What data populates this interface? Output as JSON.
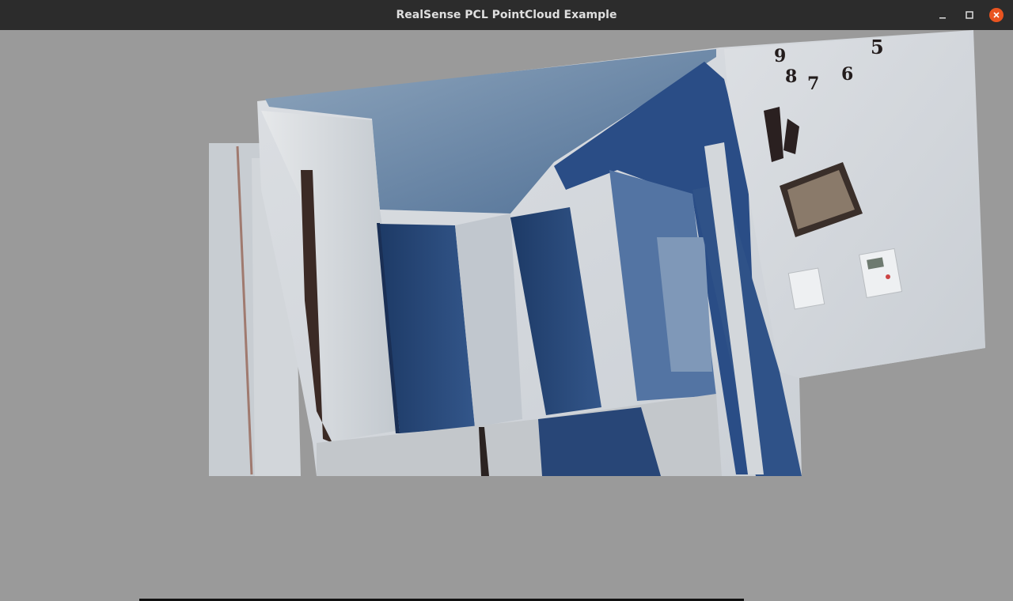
{
  "window": {
    "title": "RealSense PCL PointCloud Example"
  },
  "controls": {
    "minimize": "minimize-icon",
    "maximize": "maximize-icon",
    "close": "close-icon"
  },
  "wall_digits": [
    "9",
    "8",
    "7",
    "6",
    "5"
  ],
  "colors": {
    "titlebar": "#2c2c2c",
    "title_text": "#dfdfdf",
    "close_accent": "#e95420",
    "background": "#9a9a9a",
    "door_blue": "#2a4a7a",
    "wall_white": "#d8dde2",
    "ceiling_blue": "#6c87a4"
  }
}
